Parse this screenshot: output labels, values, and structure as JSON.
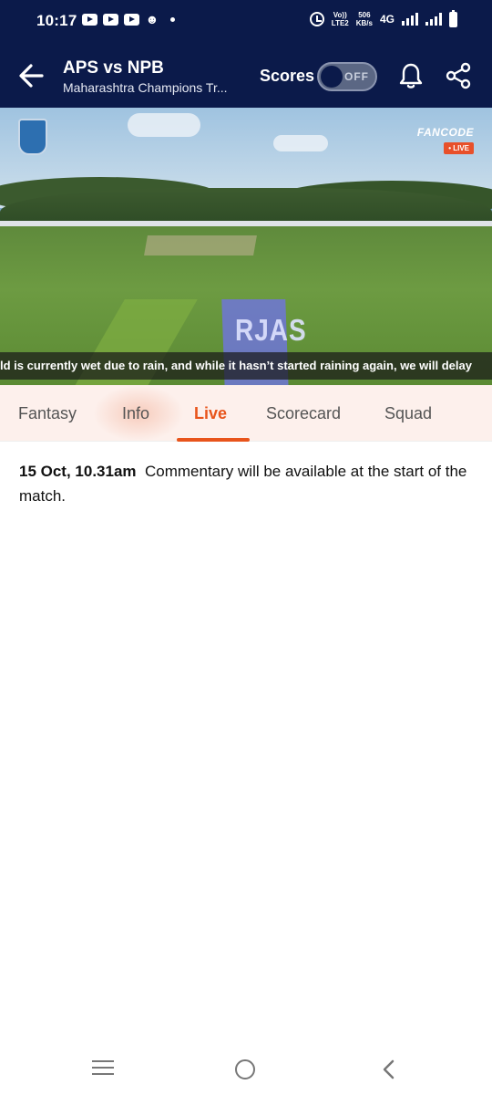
{
  "status_bar": {
    "time": "10:17",
    "net_label_top": "Vo))",
    "net_label_bottom": "LTE2",
    "speed_top": "506",
    "speed_bottom": "KB/s",
    "network": "4G"
  },
  "header": {
    "title": "APS vs NPB",
    "subtitle": "Maharashtra Champions Tr...",
    "scores_label": "Scores",
    "scores_toggle": "OFF"
  },
  "video": {
    "broadcaster": "FANCODE",
    "live_badge": "• LIVE",
    "ticker": "ld  is currently wet due to rain, and while it hasn’t started raining again, we will delay",
    "mat_text": "RJAS"
  },
  "tabs": [
    {
      "label": "Fantasy"
    },
    {
      "label": "Info"
    },
    {
      "label": "Live"
    },
    {
      "label": "Scorecard"
    },
    {
      "label": "Squad"
    }
  ],
  "active_tab": "Live",
  "commentary": {
    "timestamp": "15 Oct, 10.31am",
    "message": "Commentary will be available at the start of the match."
  },
  "colors": {
    "header_bg": "#0b1a4a",
    "accent": "#e8541b",
    "tab_bg": "#fdf0ec"
  }
}
